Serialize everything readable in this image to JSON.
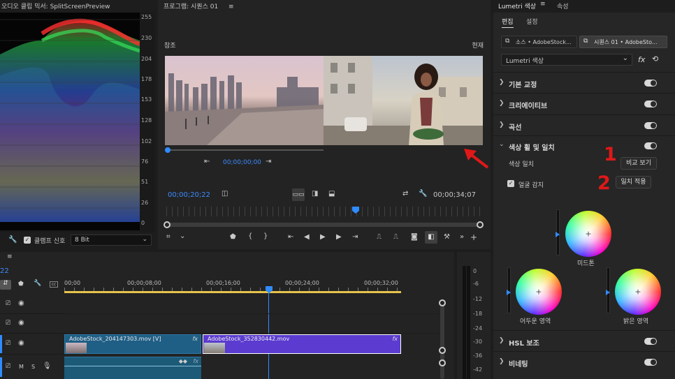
{
  "scope": {
    "header": "오디오 클립 믹서: SplitScreenPreview",
    "scale": [
      "255",
      "230",
      "204",
      "178",
      "153",
      "128",
      "102",
      "76",
      "51",
      "26",
      "0"
    ],
    "clamp_label": "클램프 신호",
    "bit_depth": "8 Bit"
  },
  "program": {
    "header": "프로그램: 시퀀스 01",
    "menu_icon": "≡",
    "ref_label": "참조",
    "cur_label": "현재",
    "ref_timecode": "00;00;00;00",
    "timecode_left": "00;00;20;22",
    "timecode_right": "00;00;34;07"
  },
  "timeline": {
    "current_time": "22",
    "ruler": [
      "00;00",
      "00;00;08;00",
      "00;00;16;00",
      "00;00;24;00",
      "00;00;32;00"
    ],
    "track_buttons": [
      "M",
      "S"
    ],
    "clip1_name": "AdobeStock_204147303.mov [V]",
    "clip2_name": "AdobeStock_352830442.mov",
    "fx_label": "fx"
  },
  "meter": {
    "scale": [
      "0",
      "-6",
      "-12",
      "-18",
      "-24",
      "-30",
      "-36",
      "-42"
    ]
  },
  "lumetri": {
    "title": "Lumetri 색상",
    "tab_props": "속성",
    "sub_tab_edit": "편집",
    "sub_tab_settings": "설정",
    "source_btn": "소스 • AdobeStock...",
    "seq_btn": "시퀀스 01 • AdobeSto...",
    "effect_dropdown": "Lumetri 색상",
    "fx_label": "fx",
    "sections": {
      "basic": "기본 교정",
      "creative": "크리에이티브",
      "curves": "곡선",
      "wheels": "색상 휠 및 일치",
      "hsl": "HSL 보조",
      "vignette": "비네팅"
    },
    "color_match_label": "색상 일치",
    "compare_btn": "비교 보기",
    "face_detect_label": "얼굴 감지",
    "apply_match_btn": "일치 적용",
    "midtones": "미드톤",
    "shadows": "어두운 영역",
    "highlights": "밝은 영역",
    "step1": "1",
    "step2": "2"
  },
  "colors": {
    "accent": "#2f8cff",
    "clip1": "#1f5f86",
    "clip2": "#5b3bd0",
    "step": "#e01818"
  }
}
